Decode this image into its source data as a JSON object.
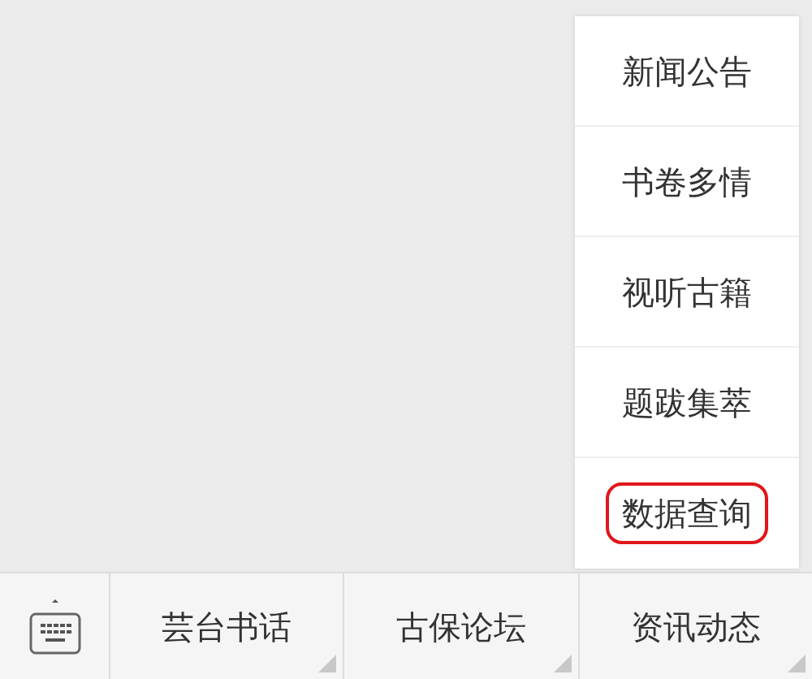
{
  "popup_menu": {
    "items": [
      {
        "label": "新闻公告",
        "highlighted": false
      },
      {
        "label": "书卷多情",
        "highlighted": false
      },
      {
        "label": "视听古籍",
        "highlighted": false
      },
      {
        "label": "题跋集萃",
        "highlighted": false
      },
      {
        "label": "数据查询",
        "highlighted": true
      }
    ]
  },
  "bottom_menu": {
    "items": [
      {
        "label": "芸台书话",
        "has_submenu": true
      },
      {
        "label": "古保论坛",
        "has_submenu": true
      },
      {
        "label": "资讯动态",
        "has_submenu": true
      }
    ]
  }
}
